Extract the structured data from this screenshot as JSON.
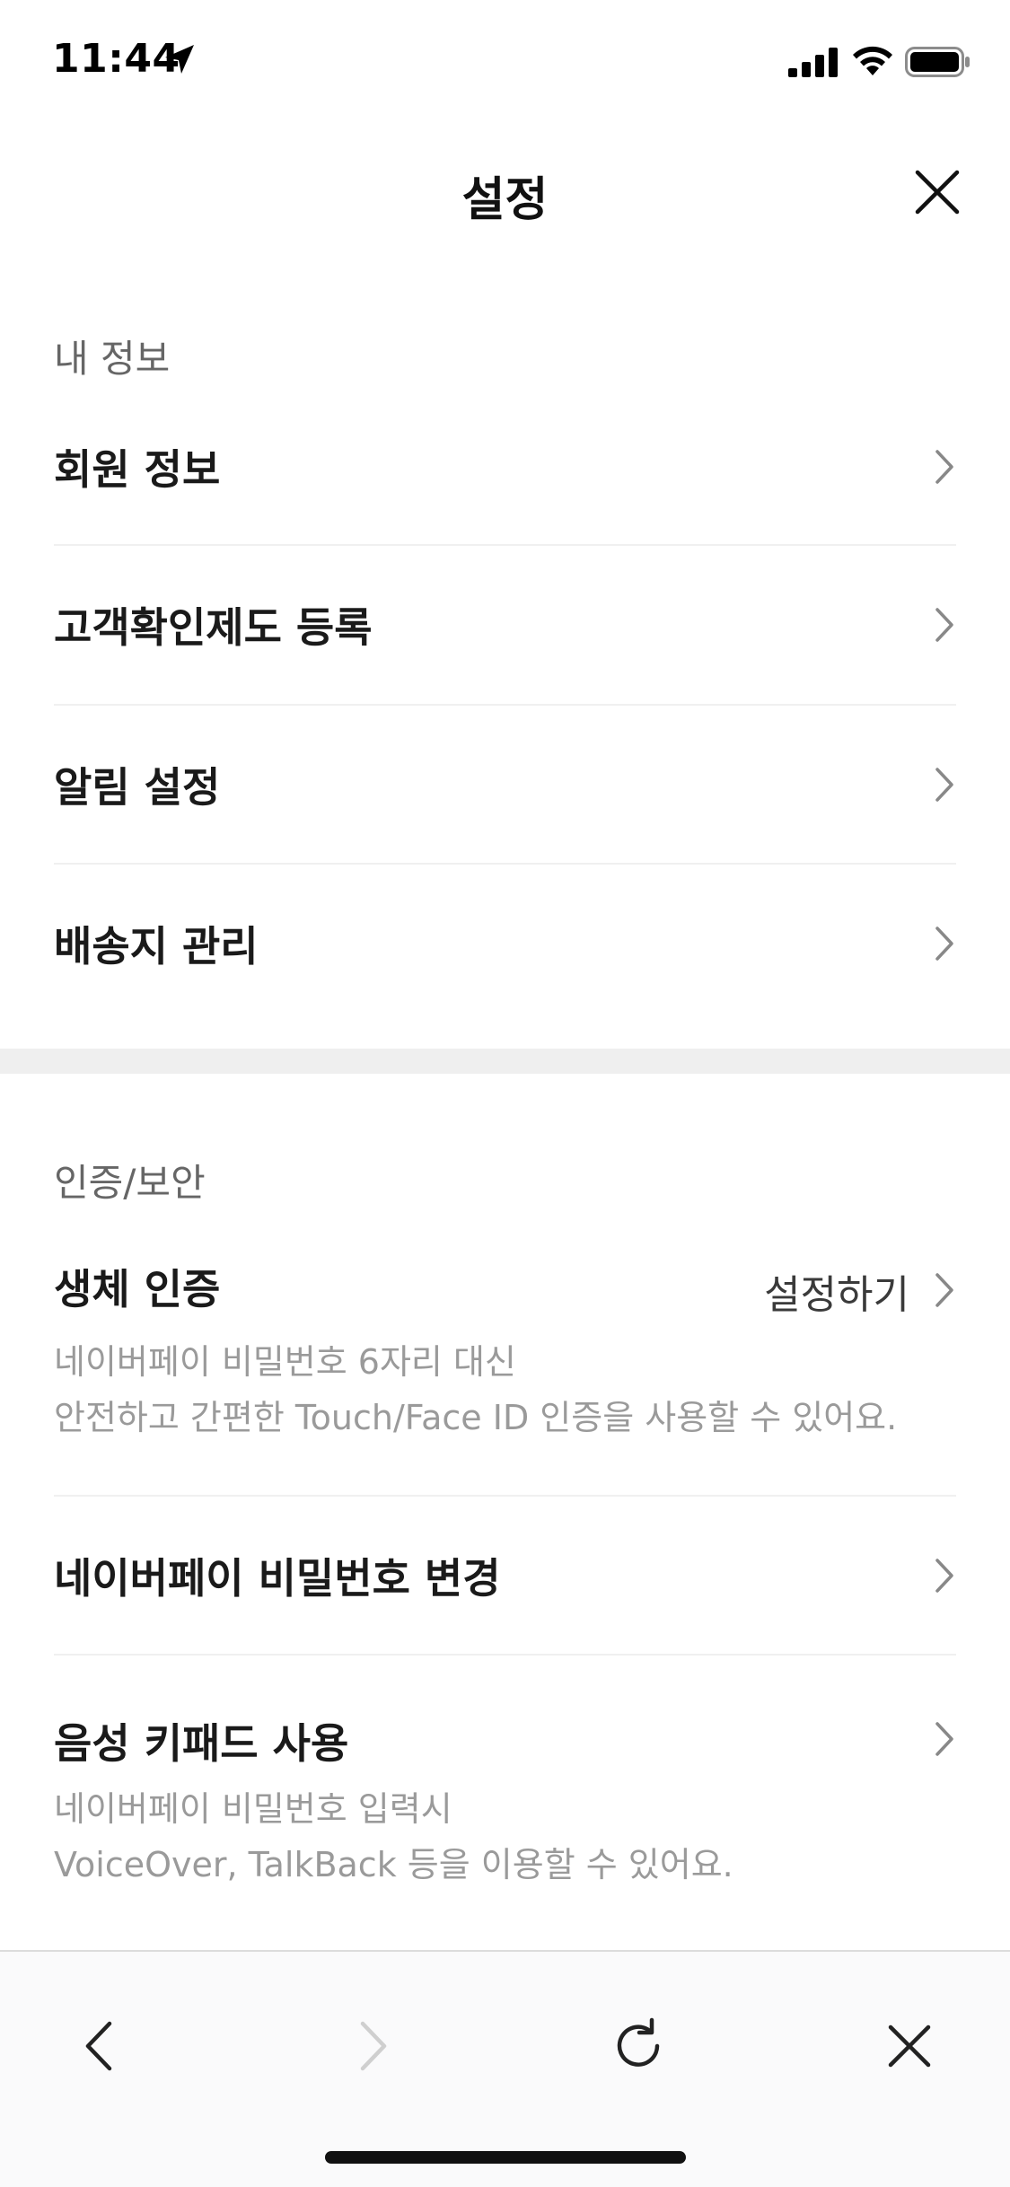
{
  "status_bar": {
    "time": "11:44"
  },
  "header": {
    "title": "설정"
  },
  "sections": {
    "my_info": {
      "label": "내 정보",
      "items": [
        {
          "label": "회원 정보"
        },
        {
          "label": "고객확인제도 등록"
        },
        {
          "label": "알림 설정"
        },
        {
          "label": "배송지 관리"
        }
      ]
    },
    "auth": {
      "label": "인증/보안",
      "biometric": {
        "label": "생체 인증",
        "action": "설정하기",
        "desc_line1": "네이버페이 비밀번호 6자리 대신",
        "desc_line2": "안전하고 간편한 Touch/Face ID 인증을 사용할 수 있어요."
      },
      "change_password": {
        "label": "네이버페이 비밀번호 변경"
      },
      "voice_keypad": {
        "label": "음성 키패드 사용",
        "desc_line1": "네이버페이 비밀번호 입력시",
        "desc_line2": "VoiceOver, TalkBack 등을 이용할 수 있어요."
      }
    }
  },
  "toolbar": {
    "icons": [
      "back-icon",
      "forward-icon",
      "refresh-icon",
      "close-icon"
    ],
    "forward_disabled": true
  },
  "colors": {
    "text_primary": "#1a1a1a",
    "text_secondary": "#666666",
    "text_description": "#9a9a9a",
    "section_gap": "#efefef",
    "toolbar_bg": "#fafafb"
  }
}
